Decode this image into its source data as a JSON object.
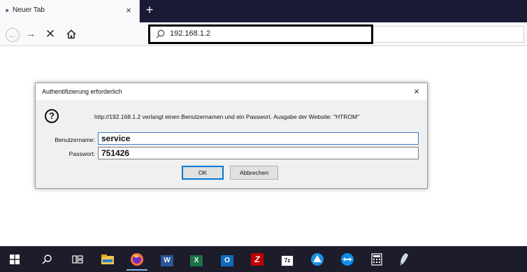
{
  "browser": {
    "tab": {
      "title": "Neuer Tab",
      "close_glyph": "×"
    },
    "new_tab_glyph": "+",
    "nav": {
      "back_glyph": "←",
      "forward_glyph": "→",
      "stop_glyph": "✕"
    },
    "url": "192.168.1.2"
  },
  "dialog": {
    "title": "Authentifizierung erforderlich",
    "close_glyph": "×",
    "icon_glyph": "?",
    "message": "http://192.168.1.2 verlangt einen Benutzernamen und ein Passwort. Ausgabe der Website: \"HTROM\"",
    "username_label": "Benutzername:",
    "username_value": "service",
    "password_label": "Passwort:",
    "password_value": "751426",
    "ok_label": "OK",
    "cancel_label": "Abbrechen"
  },
  "taskbar": {
    "items": [
      {
        "name": "windows-start-icon"
      },
      {
        "name": "search-icon"
      },
      {
        "name": "task-view-icon"
      },
      {
        "name": "file-explorer-icon"
      },
      {
        "name": "firefox-icon"
      },
      {
        "name": "word-icon",
        "glyph": "W"
      },
      {
        "name": "excel-icon",
        "glyph": "X"
      },
      {
        "name": "outlook-icon",
        "glyph": "O"
      },
      {
        "name": "filezilla-icon",
        "glyph": "Z"
      },
      {
        "name": "7zip-icon",
        "glyph": "7z"
      },
      {
        "name": "triangle-app-icon"
      },
      {
        "name": "teamviewer-icon"
      },
      {
        "name": "calculator-icon"
      },
      {
        "name": "pen-app-icon"
      }
    ]
  },
  "colors": {
    "tabstrip": "#1a1a36",
    "taskbar": "#1c1c2a",
    "ok_border": "#0078d7"
  }
}
